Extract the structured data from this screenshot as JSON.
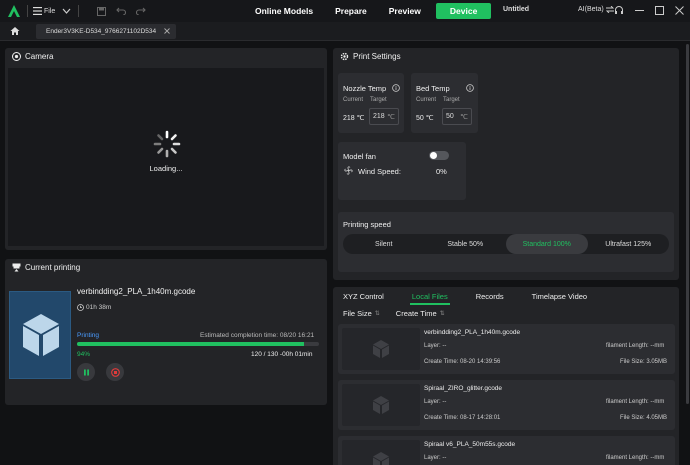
{
  "titlebar": {
    "file_label": "File",
    "nav": [
      "Online Models",
      "Prepare",
      "Preview",
      "Device"
    ],
    "project_title": "Untitled",
    "ai_label": "AI(Beta)"
  },
  "tabbar": {
    "device_tab": "Ender3V3KE-D534_9766271102D534"
  },
  "camera": {
    "title": "Camera",
    "loading": "Loading..."
  },
  "current_printing": {
    "title": "Current printing",
    "file_name": "verbindding2_PLA_1h40m.gcode",
    "duration": "01h 38m",
    "status": "Printing",
    "eta": "Estimated completion time: 08/20 16:21",
    "progress_pct": 94,
    "progress_label": "94%",
    "layers": "120 / 130",
    "remaining": "-00h 01min"
  },
  "print_settings": {
    "title": "Print Settings",
    "nozzle": {
      "title": "Nozzle Temp",
      "current_lbl": "Current",
      "target_lbl": "Target",
      "current": "218 ℃",
      "target": "218",
      "unit": "℃"
    },
    "bed": {
      "title": "Bed Temp",
      "current_lbl": "Current",
      "target_lbl": "Target",
      "current": "50 ℃",
      "target": "50",
      "unit": "℃"
    },
    "fan": {
      "title": "Model fan",
      "wind_label": "Wind Speed:",
      "wind_value": "0%",
      "enabled": false
    },
    "speed": {
      "title": "Printing speed",
      "options": [
        "Silent",
        "Stable 50%",
        "Standard 100%",
        "Ultrafast 125%"
      ],
      "selected": "Standard 100%"
    }
  },
  "files": {
    "tabs": [
      "XYZ Control",
      "Local Files",
      "Records",
      "Timelapse Video"
    ],
    "active_tab": "Local Files",
    "sort": [
      "File Size",
      "Create Time"
    ],
    "items": [
      {
        "name": "verbindding2_PLA_1h40m.gcode",
        "layer": "Layer: --",
        "filament": "filament Length: --mm",
        "ctime": "Create Time: 08-20 14:39:56",
        "size": "File Size: 3.05MB"
      },
      {
        "name": "Spiraal_ZIRO_glitter.gcode",
        "layer": "Layer: --",
        "filament": "filament Length: --mm",
        "ctime": "Create Time: 08-17 14:28:01",
        "size": "File Size: 4.05MB"
      },
      {
        "name": "Spiraal v6_PLA_50m55s.gcode",
        "layer": "Layer: --",
        "filament": "filament Length: --mm",
        "ctime": "",
        "size": ""
      }
    ]
  },
  "colors": {
    "accent": "#20c060",
    "status_blue": "#4a9cff",
    "panel": "#232427",
    "bg": "#111214"
  }
}
